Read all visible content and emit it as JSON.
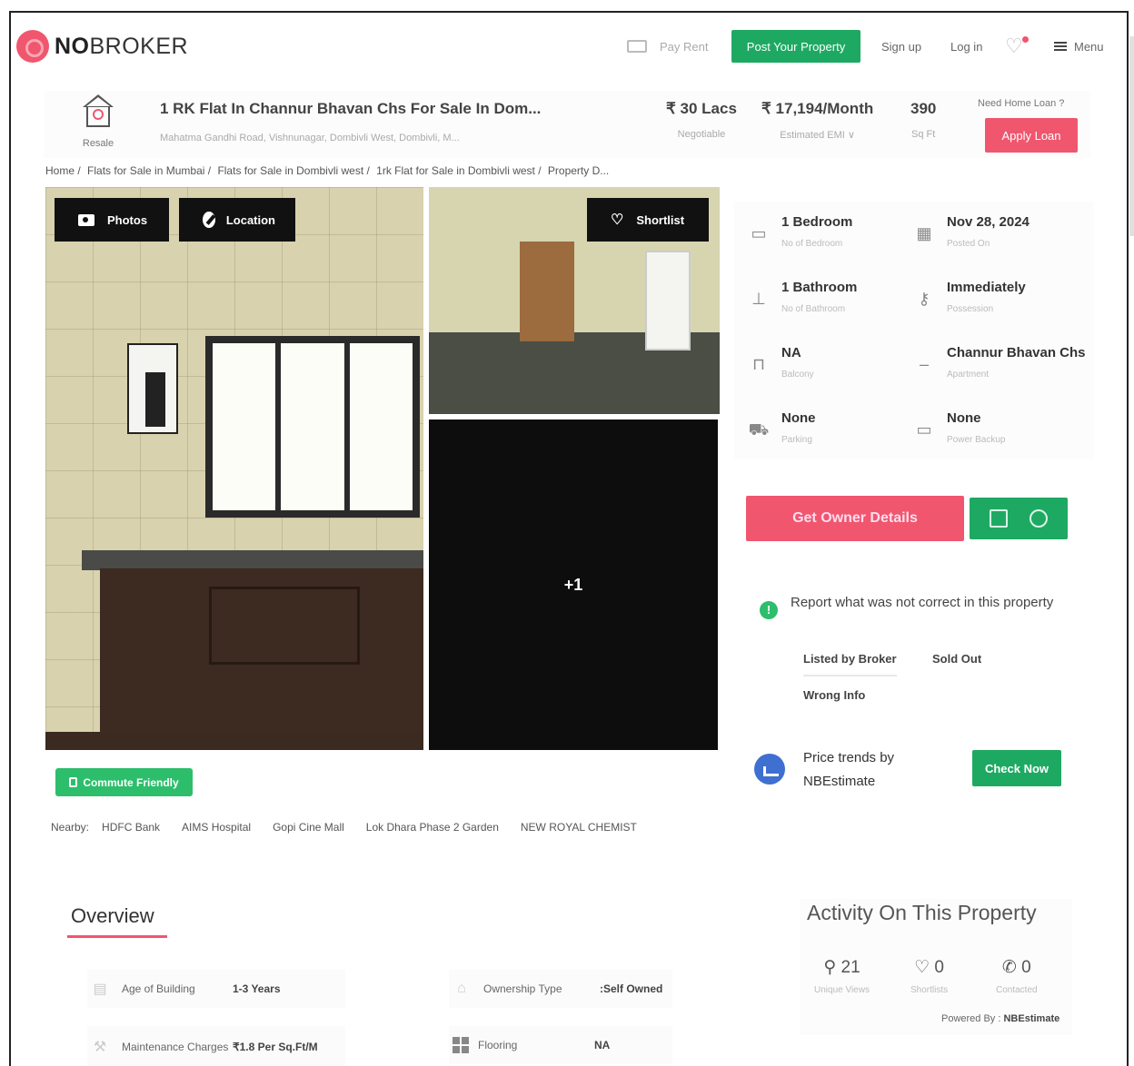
{
  "header": {
    "logo_prefix": "NO",
    "logo_suffix": "BROKER",
    "pay_rent": "Pay Rent",
    "post_property": "Post Your Property",
    "sign_up": "Sign up",
    "log_in": "Log in",
    "menu": "Menu"
  },
  "listing": {
    "type_label": "Resale",
    "title": "1 RK Flat In Channur Bhavan Chs For Sale In Dom...",
    "address": "Mahatma Gandhi Road, Vishnunagar, Dombivli West, Dombivli, M...",
    "price": "₹ 30 Lacs",
    "price_note": "Negotiable",
    "emi": "₹ 17,194/Month",
    "emi_note": "Estimated EMI ∨",
    "area": "390",
    "area_unit": "Sq Ft",
    "home_loan_prompt": "Need Home Loan ?",
    "apply_loan": "Apply Loan"
  },
  "breadcrumb": [
    "Home /",
    "Flats for Sale in Mumbai /",
    "Flats for Sale in Dombivli west /",
    "1rk Flat for Sale in Dombivli west /",
    "Property D..."
  ],
  "gallery": {
    "photos_btn": "Photos",
    "location_btn": "Location",
    "shortlist_btn": "Shortlist",
    "more_count": "+1"
  },
  "commute_badge": "Commute Friendly",
  "nearby": {
    "label": "Nearby:",
    "items": [
      "HDFC Bank",
      "AIMS Hospital",
      "Gopi Cine Mall",
      "Lok Dhara Phase 2 Garden",
      "NEW ROYAL CHEMIST"
    ]
  },
  "details": [
    {
      "value": "1 Bedroom",
      "label": "No of Bedroom",
      "icon": "bed-icon"
    },
    {
      "value": "Nov 28, 2024",
      "label": "Posted On",
      "icon": "calendar-icon"
    },
    {
      "value": "1 Bathroom",
      "label": "No of Bathroom",
      "icon": "bath-icon"
    },
    {
      "value": "Immediately",
      "label": "Possession",
      "icon": "key-icon"
    },
    {
      "value": "NA",
      "label": "Balcony",
      "icon": "balcony-icon"
    },
    {
      "value": "Channur Bhavan Chs",
      "label": "Apartment",
      "icon": "building-icon"
    },
    {
      "value": "None",
      "label": "Parking",
      "icon": "car-icon"
    },
    {
      "value": "None",
      "label": "Power Backup",
      "icon": "battery-icon"
    }
  ],
  "cta": {
    "owner_details": "Get Owner Details"
  },
  "report": {
    "text": "Report what was not correct in this property",
    "options": [
      "Listed by Broker",
      "Sold Out",
      "Wrong Info"
    ]
  },
  "trends": {
    "text": "Price trends by NBEstimate",
    "button": "Check Now"
  },
  "overview": {
    "title": "Overview",
    "rows": [
      {
        "key": "Age of Building",
        "value": "1-3 Years"
      },
      {
        "key": "Ownership Type",
        "value": ":Self Owned"
      },
      {
        "key": "Maintenance Charges",
        "value": "₹1.8 Per Sq.Ft/M"
      },
      {
        "key": "Flooring",
        "value": "NA"
      }
    ]
  },
  "activity": {
    "title": "Activity On This Property",
    "stats": [
      {
        "value": "21",
        "label": "Unique Views",
        "icon": "user-icon"
      },
      {
        "value": "0",
        "label": "Shortlists",
        "icon": "heart-icon"
      },
      {
        "value": "0",
        "label": "Contacted",
        "icon": "phone-icon"
      }
    ],
    "powered_label": "Powered By :",
    "powered_brand": "NBEstimate"
  },
  "colors": {
    "brand_red": "#f0566e",
    "brand_green": "#1ea963"
  }
}
